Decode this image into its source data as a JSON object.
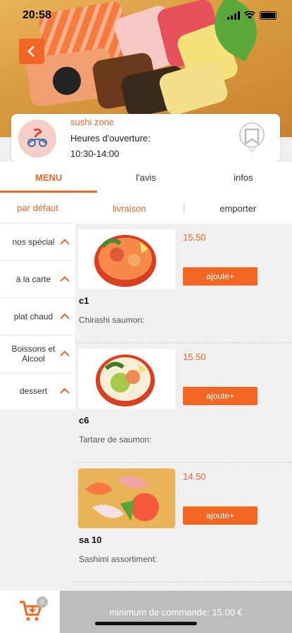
{
  "status_bar": {
    "time": "20:58"
  },
  "shop": {
    "name": "sushi zone",
    "hours_label": "Heures d'ouverture:",
    "hours_value": "10:30-14:00"
  },
  "tabs": [
    {
      "label": "MENU",
      "active": true
    },
    {
      "label": "l'avis",
      "active": false
    },
    {
      "label": "infos",
      "active": false
    }
  ],
  "sidebar": {
    "default_label": "par défaut",
    "categories": [
      {
        "label": "nos spécial"
      },
      {
        "label": "à la carte"
      },
      {
        "label": "plat chaud"
      },
      {
        "label": "Boissons et Alcool"
      },
      {
        "label": "dessert"
      }
    ]
  },
  "filters": {
    "left": "livraison",
    "right": "emporter"
  },
  "products": [
    {
      "code": "c1",
      "name": "Chirashi saumon:",
      "price": "15.50",
      "add_label": "ajoute+"
    },
    {
      "code": "c6",
      "name": "Tartare de saumon:",
      "price": "15.50",
      "add_label": "ajoute+"
    },
    {
      "code": "sa 10",
      "name": "Sashimi assortiment:",
      "price": "14.50",
      "add_label": "ajoute+"
    }
  ],
  "cart": {
    "count": "0"
  },
  "min_order": "minimum de commande: 15.00 €",
  "colors": {
    "accent": "#f26522",
    "bottom_bar": "#bdbdbd"
  },
  "icons": {
    "back": "chevron-left-icon",
    "cart": "cart-icon",
    "fav": "badge-icon"
  }
}
